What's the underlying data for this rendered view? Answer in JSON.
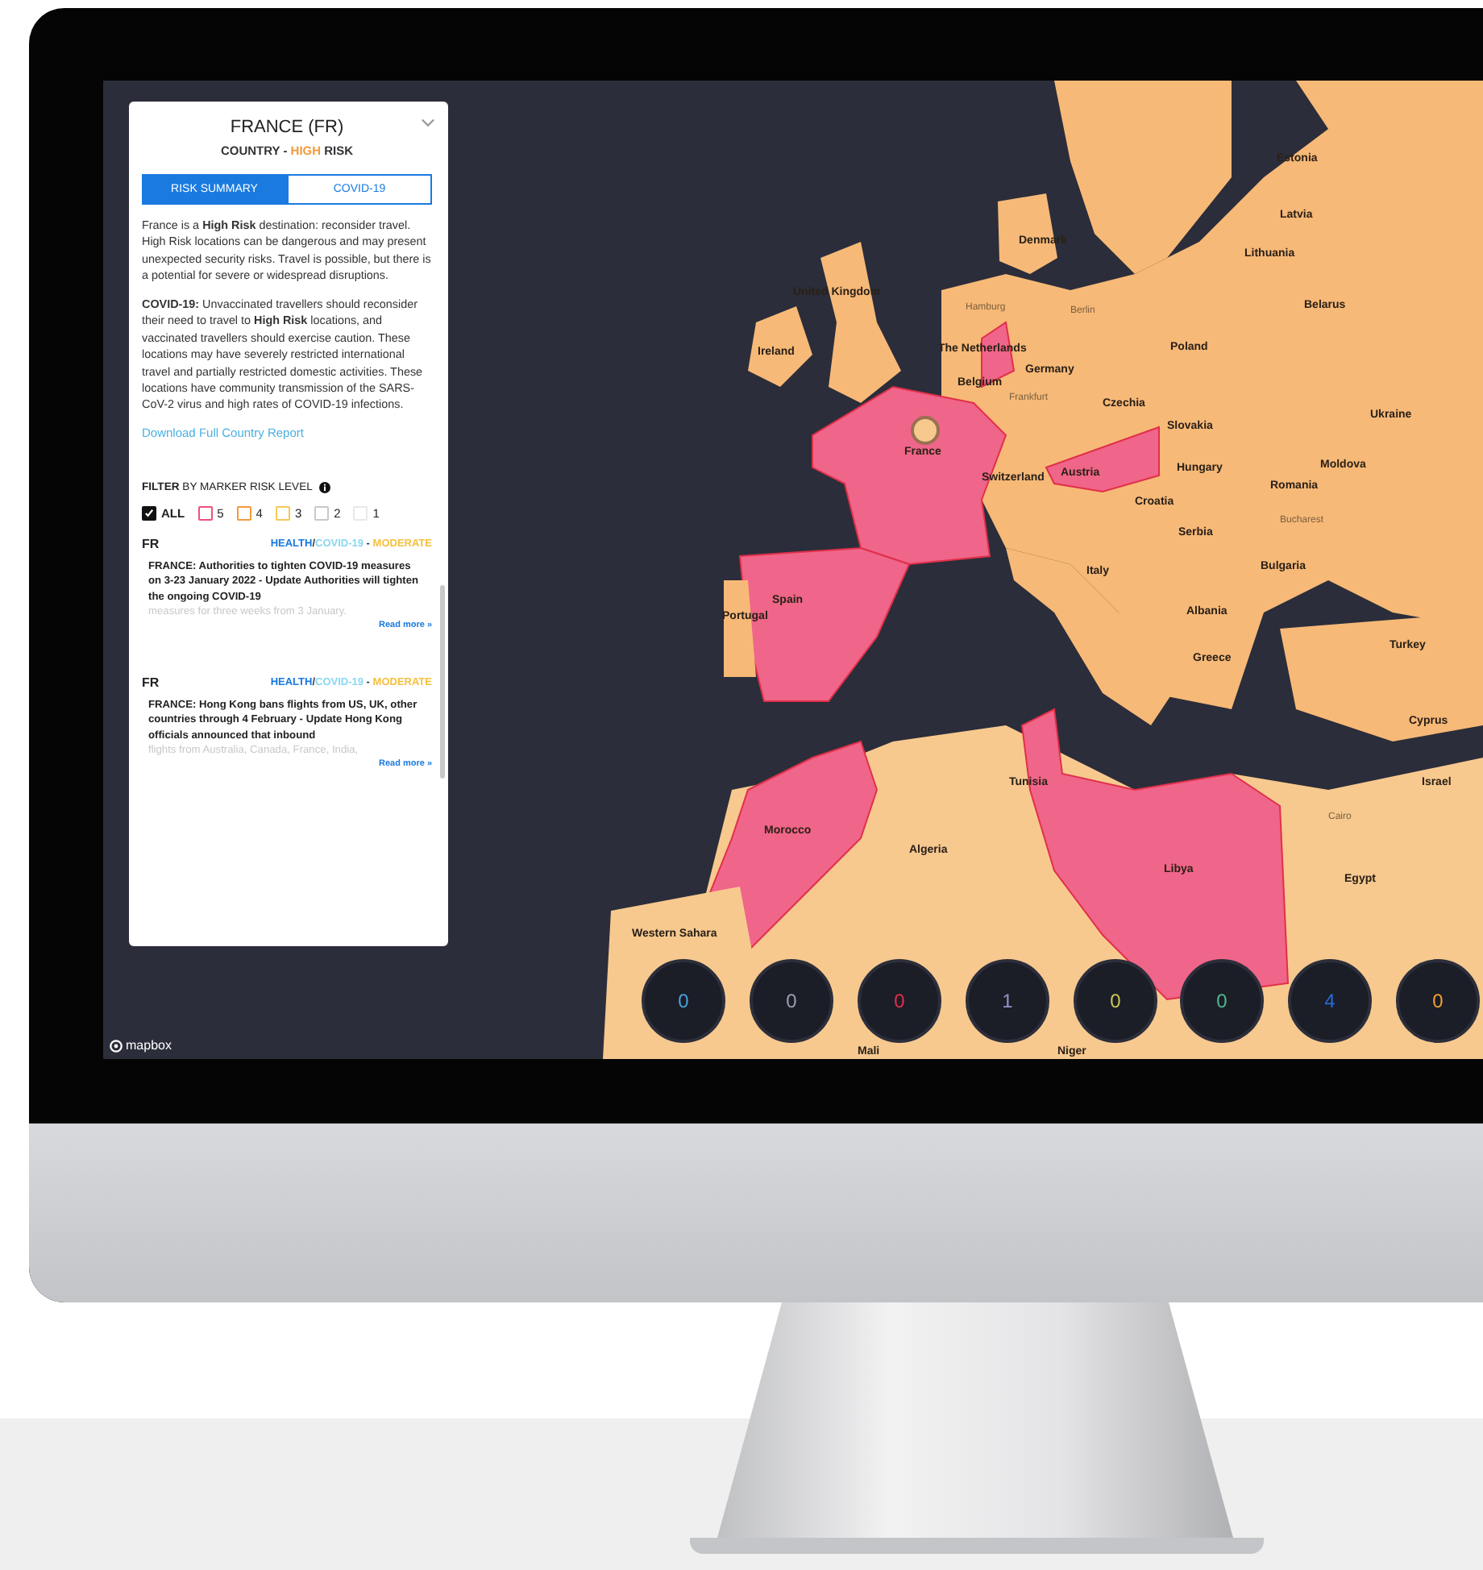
{
  "panel": {
    "title": "FRANCE (FR)",
    "subtitle": {
      "prefix": "COUNTRY - ",
      "highlight": "HIGH",
      "suffix": " RISK"
    },
    "tabs": [
      {
        "label": "RISK SUMMARY",
        "selected": true
      },
      {
        "label": "COVID-19",
        "selected": false
      }
    ],
    "paragraphs": [
      "France is a **High Risk** destination: reconsider travel. High Risk locations can be dangerous and may present unexpected security risks. Travel is possible, but there is a potential for severe or widespread disruptions.",
      "**COVID-19:** Unvaccinated travellers should reconsider their need to travel to **High Risk** locations, and vaccinated travellers should exercise caution. These locations may have severely restricted international travel and partially restricted domestic activities. These locations have community transmission of the SARS-CoV-2 virus and high rates of COVID-19 infections."
    ],
    "report_link": "Download Full Country Report",
    "filter_heading": "**FILTER** BY MARKER RISK LEVEL",
    "filters": [
      {
        "label": "ALL",
        "checked": true,
        "color": "#111111"
      },
      {
        "label": "5",
        "checked": false,
        "color": "#f0507a"
      },
      {
        "label": "4",
        "checked": false,
        "color": "#f39a3c"
      },
      {
        "label": "3",
        "checked": false,
        "color": "#f5c85a"
      },
      {
        "label": "2",
        "checked": false,
        "color": "#c8c8c8"
      },
      {
        "label": "1",
        "checked": false,
        "color": "#e8e8e8"
      }
    ],
    "alerts": [
      {
        "code": "FR",
        "category": "HEALTH",
        "separator": "/",
        "subcategory": "COVID-19",
        "dash": "-",
        "severity": "MODERATE",
        "headline": "FRANCE: Authorities to tighten COVID-19 measures on 3-23 January 2022 - Update Authorities will tighten the ongoing COVID-19",
        "excerpt": "measures for three weeks from 3 January.",
        "more": "Read more »"
      },
      {
        "code": "FR",
        "category": "HEALTH",
        "separator": "/",
        "subcategory": "COVID-19",
        "dash": "-",
        "severity": "MODERATE",
        "headline": "FRANCE: Hong Kong bans flights from US, UK, other countries through 4 February - Update Hong Kong officials announced that inbound",
        "excerpt": "flights from Australia, Canada, France, India,",
        "more": "Read more »"
      }
    ]
  },
  "map_labels": [
    {
      "text": "Ireland",
      "kind": "country"
    },
    {
      "text": "United Kingdom",
      "kind": "country"
    },
    {
      "text": "Denmark",
      "kind": "country"
    },
    {
      "text": "The Netherlands",
      "kind": "country"
    },
    {
      "text": "Belgium",
      "kind": "country"
    },
    {
      "text": "Germany",
      "kind": "country"
    },
    {
      "text": "Hamburg",
      "kind": "city"
    },
    {
      "text": "Berlin",
      "kind": "city"
    },
    {
      "text": "Frankfurt",
      "kind": "city"
    },
    {
      "text": "Poland",
      "kind": "country"
    },
    {
      "text": "Lithuania",
      "kind": "country"
    },
    {
      "text": "Estonia",
      "kind": "country"
    },
    {
      "text": "Latvia",
      "kind": "country"
    },
    {
      "text": "Belarus",
      "kind": "country"
    },
    {
      "text": "Ukraine",
      "kind": "country"
    },
    {
      "text": "Czechia",
      "kind": "country"
    },
    {
      "text": "Slovakia",
      "kind": "country"
    },
    {
      "text": "Austria",
      "kind": "country"
    },
    {
      "text": "Hungary",
      "kind": "country"
    },
    {
      "text": "Moldova",
      "kind": "country"
    },
    {
      "text": "Romania",
      "kind": "country"
    },
    {
      "text": "Bucharest",
      "kind": "city"
    },
    {
      "text": "Switzerland",
      "kind": "country"
    },
    {
      "text": "France",
      "kind": "country"
    },
    {
      "text": "Croatia",
      "kind": "country"
    },
    {
      "text": "Serbia",
      "kind": "country"
    },
    {
      "text": "Bulgaria",
      "kind": "country"
    },
    {
      "text": "Italy",
      "kind": "country"
    },
    {
      "text": "Albania",
      "kind": "country"
    },
    {
      "text": "Greece",
      "kind": "country"
    },
    {
      "text": "Turkey",
      "kind": "country"
    },
    {
      "text": "Spain",
      "kind": "country"
    },
    {
      "text": "Portugal",
      "kind": "country"
    },
    {
      "text": "Morocco",
      "kind": "country"
    },
    {
      "text": "Tunisia",
      "kind": "country"
    },
    {
      "text": "Algeria",
      "kind": "country"
    },
    {
      "text": "Libya",
      "kind": "country"
    },
    {
      "text": "Egypt",
      "kind": "country"
    },
    {
      "text": "Cairo",
      "kind": "city"
    },
    {
      "text": "Cyprus",
      "kind": "country"
    },
    {
      "text": "Israel",
      "kind": "country"
    },
    {
      "text": "Western Sahara",
      "kind": "country"
    },
    {
      "text": "Mali",
      "kind": "country"
    },
    {
      "text": "Niger",
      "kind": "country"
    }
  ],
  "counters": [
    {
      "value": "0",
      "color": "#4aa3d8"
    },
    {
      "value": "0",
      "color": "#9aa0b0"
    },
    {
      "value": "0",
      "color": "#e0304a"
    },
    {
      "value": "1",
      "color": "#9a90c8"
    },
    {
      "value": "0",
      "color": "#c8c850"
    },
    {
      "value": "0",
      "color": "#50b890"
    },
    {
      "value": "4",
      "color": "#2a6ad8"
    },
    {
      "value": "0",
      "color": "#f0a030"
    }
  ],
  "attribution": "mapbox"
}
